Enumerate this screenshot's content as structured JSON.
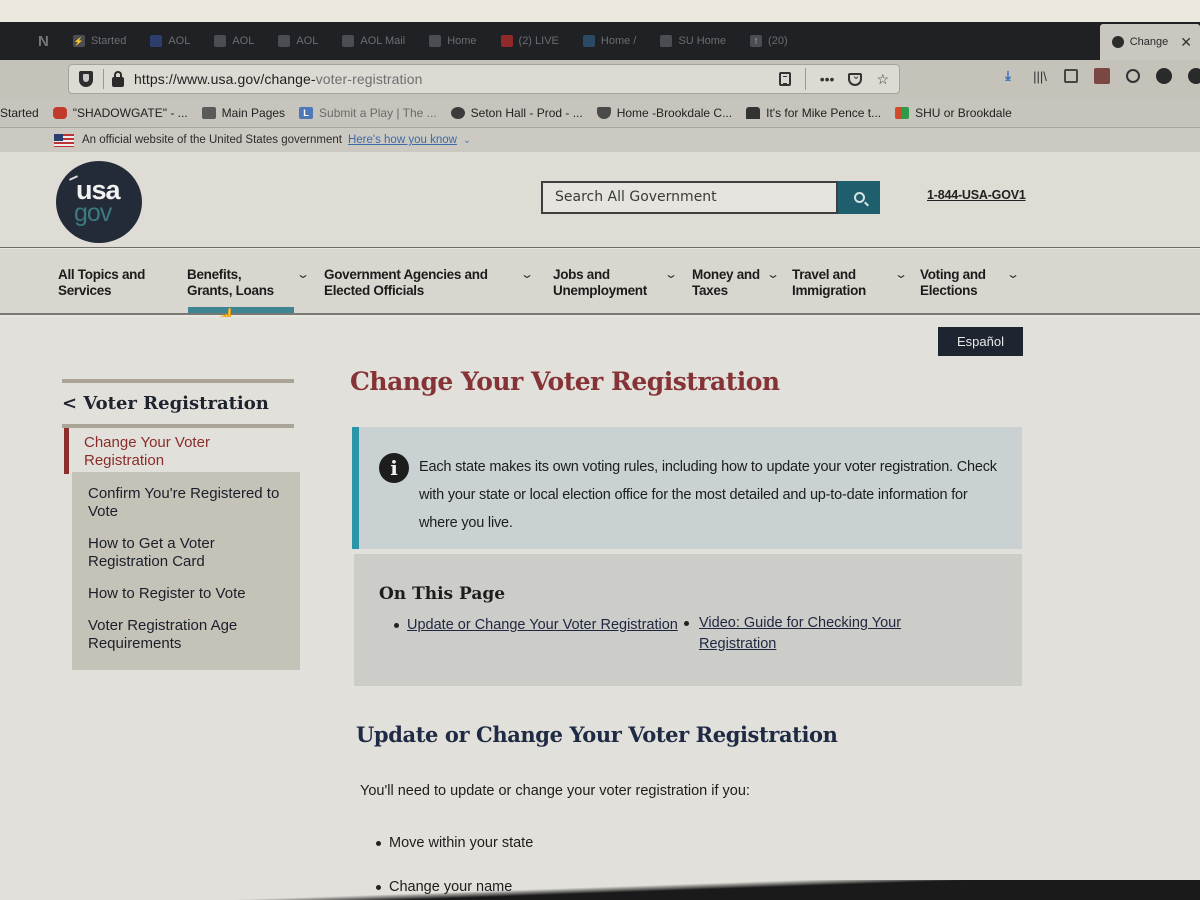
{
  "browser": {
    "tabs": [
      {
        "label": "N",
        "icon": "netflix-icon"
      },
      {
        "label": "Started",
        "icon": "bolt-icon"
      },
      {
        "label": "AOL",
        "icon": "aol-icon"
      },
      {
        "label": "AOL",
        "icon": "aol-icon"
      },
      {
        "label": "AOL",
        "icon": "aol-icon"
      },
      {
        "label": "AOL Mail",
        "icon": "aol-icon"
      },
      {
        "label": "Home",
        "icon": "home-icon"
      },
      {
        "label": "(2) LIVE",
        "icon": "youtube-icon"
      },
      {
        "label": "Home /",
        "icon": "twitter-icon"
      },
      {
        "label": "SU Home",
        "icon": "site-icon"
      },
      {
        "label": "(20)",
        "icon": "facebook-icon"
      }
    ],
    "active_tab": {
      "label": "Change",
      "icon": "page-icon"
    },
    "url": {
      "main": "https://www.usa.gov/change-",
      "faded": "voter-registration"
    },
    "bookmarks": [
      {
        "label": "Started",
        "icon": "none"
      },
      {
        "label": "\"SHADOWGATE\" - ...",
        "icon": "youtube-icon"
      },
      {
        "label": "Main  Pages",
        "icon": "folder-icon"
      },
      {
        "label": "Submit a Play | The ...",
        "icon": "letter-l-icon"
      },
      {
        "label": "Seton Hall - Prod - ...",
        "icon": "circle-icon"
      },
      {
        "label": "Home -Brookdale C...",
        "icon": "shield-icon"
      },
      {
        "label": "It's for Mike Pence t...",
        "icon": "hat-icon"
      },
      {
        "label": "SHU or Brookdale",
        "icon": "microsoft-icon"
      }
    ]
  },
  "gov_banner": {
    "text": "An official website of the United States government",
    "link": "Here's how you know"
  },
  "header": {
    "logo_top": "usa",
    "logo_bottom": "gov",
    "search_placeholder": "Search All Government",
    "phone": "1-844-USA-GOV1"
  },
  "nav": {
    "items": [
      {
        "label": "All Topics and Services",
        "line1": "All Topics and",
        "line2": "Services",
        "has_dropdown": false
      },
      {
        "label": "Benefits, Grants, Loans",
        "line1": "Benefits,",
        "line2": "Grants, Loans",
        "has_dropdown": true,
        "active": true
      },
      {
        "label": "Government Agencies and Elected Officials",
        "line1": "Government Agencies and",
        "line2": "Elected Officials",
        "has_dropdown": true
      },
      {
        "label": "Jobs and Unemployment",
        "line1": "Jobs and",
        "line2": "Unemployment",
        "has_dropdown": true
      },
      {
        "label": "Money and Taxes",
        "line1": "Money and",
        "line2": "Taxes",
        "has_dropdown": true
      },
      {
        "label": "Travel and Immigration",
        "line1": "Travel and",
        "line2": "Immigration",
        "has_dropdown": true
      },
      {
        "label": "Voting and Elections",
        "line1": "Voting and",
        "line2": "Elections",
        "has_dropdown": true
      }
    ]
  },
  "language_button": "Español",
  "sidebar": {
    "back_label": "< Voter Registration",
    "active_item": "Change Your Voter Registration",
    "items": [
      "Confirm You're Registered to Vote",
      "How to Get a Voter Registration Card",
      "How to Register to Vote",
      "Voter Registration Age Requirements"
    ]
  },
  "main": {
    "title": "Change Your Voter Registration",
    "alert": {
      "icon": "info-icon",
      "text": "Each state makes its own voting rules, including how to update your voter registration. Check with your state or local election office for the most detailed and up-to-date information for where you live."
    },
    "on_this_page": {
      "heading": "On This Page",
      "links": [
        "Update or Change Your Voter Registration",
        "Video: Guide for Checking Your Registration"
      ]
    },
    "section": {
      "title": "Update or Change Your Voter Registration",
      "intro": "You'll need to update or change your voter registration if you:",
      "bullets": [
        "Move within your state",
        "Change your name"
      ]
    }
  },
  "colors": {
    "title_red": "#853336",
    "accent_teal": "#2a96a8",
    "search_button": "#1f5f6d",
    "nav_underline": "#3c8591",
    "sidebar_active": "#8b2f2c",
    "espanol_bg": "#1e2530"
  }
}
